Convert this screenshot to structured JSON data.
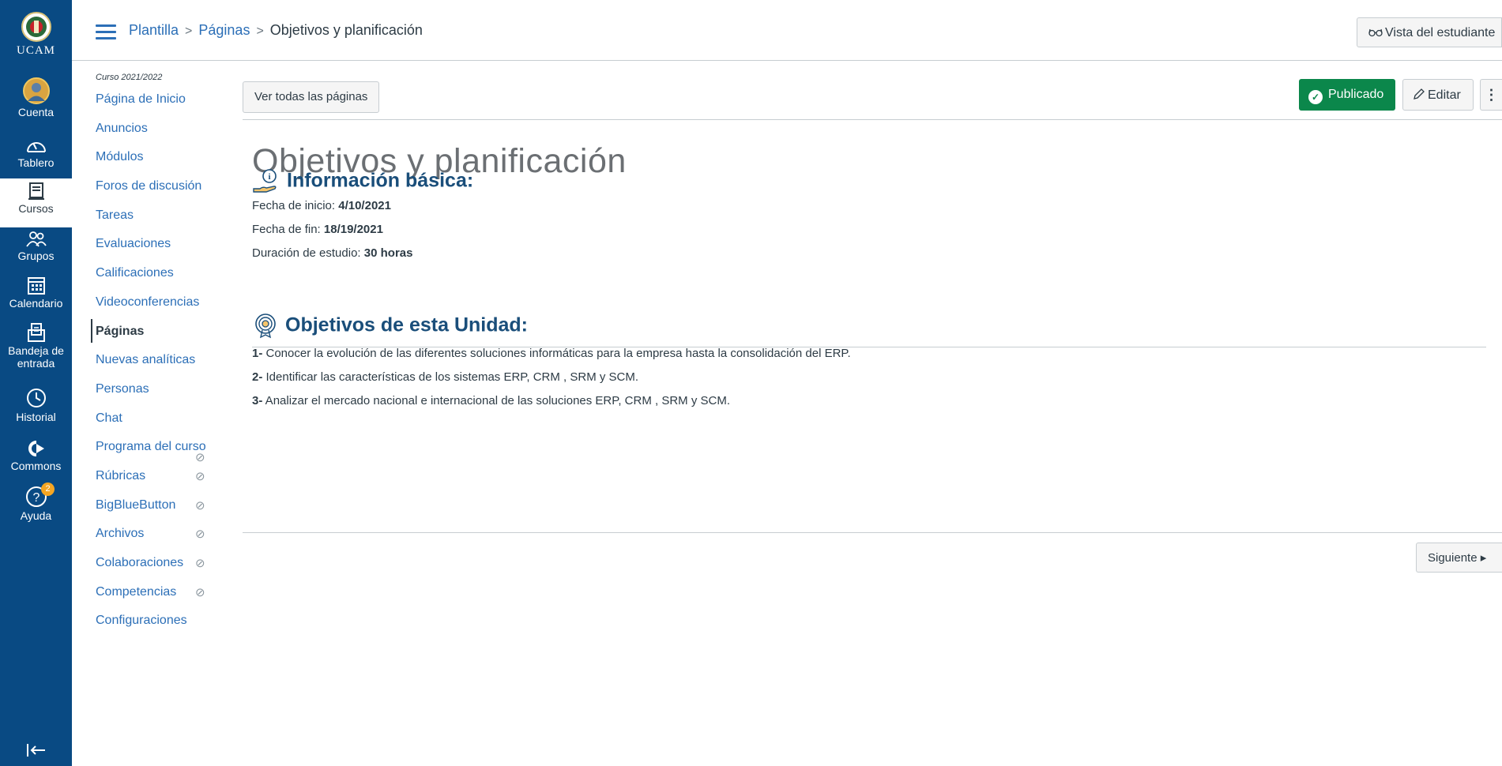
{
  "global_nav": {
    "logo_text": "UCAM",
    "items": [
      {
        "label": "Cuenta",
        "icon": "account-avatar"
      },
      {
        "label": "Tablero",
        "icon": "dashboard-icon"
      },
      {
        "label": "Cursos",
        "icon": "courses-icon"
      },
      {
        "label": "Grupos",
        "icon": "groups-icon"
      },
      {
        "label": "Calendario",
        "icon": "calendar-icon"
      },
      {
        "label_line1": "Bandeja de",
        "label_line2": "entrada",
        "icon": "inbox-icon"
      },
      {
        "label": "Historial",
        "icon": "history-icon"
      },
      {
        "label": "Commons",
        "icon": "commons-icon"
      },
      {
        "label": "Ayuda",
        "icon": "help-icon",
        "badge": "2"
      }
    ],
    "collapse_icon": "collapse-nav-icon"
  },
  "header": {
    "breadcrumb": [
      "Plantilla",
      "Páginas",
      "Objetivos y planificación"
    ],
    "student_view_label": "Vista del estudiante"
  },
  "course_nav": {
    "term": "Curso 2021/2022",
    "items": [
      {
        "label": "Página de Inicio"
      },
      {
        "label": "Anuncios"
      },
      {
        "label": "Módulos"
      },
      {
        "label": "Foros de discusión"
      },
      {
        "label": "Tareas"
      },
      {
        "label": "Evaluaciones"
      },
      {
        "label": "Calificaciones"
      },
      {
        "label": "Videoconferencias"
      },
      {
        "label": "Páginas",
        "active": true
      },
      {
        "label": "Nuevas analíticas"
      },
      {
        "label": "Personas"
      },
      {
        "label": "Chat"
      },
      {
        "label": "Programa del curso",
        "hidden": true
      },
      {
        "label": "Rúbricas",
        "hidden": true
      },
      {
        "label": "BigBlueButton",
        "hidden": true
      },
      {
        "label": "Archivos",
        "hidden": true
      },
      {
        "label": "Colaboraciones",
        "hidden": true
      },
      {
        "label": "Competencias",
        "hidden": true
      },
      {
        "label": "Configuraciones"
      }
    ]
  },
  "toolbar": {
    "view_all_label": "Ver todas las páginas",
    "published_label": "Publicado",
    "edit_label": "Editar",
    "more_label": "⋮"
  },
  "page": {
    "title": "Objetivos y planificación",
    "basic_info": {
      "heading": "Información básica:",
      "start_label": "Fecha de inicio: ",
      "start_value": "4/10/2021",
      "end_label": "Fecha de fin: ",
      "end_value": "18/19/2021",
      "duration_label": "Duración de estudio: ",
      "duration_value": "30 horas"
    },
    "objectives": {
      "heading": "Objetivos de esta Unidad:",
      "items": [
        {
          "num": "1-",
          "text": " Conocer la evolución de las diferentes soluciones informáticas para la empresa hasta la consolidación del ERP."
        },
        {
          "num": "2-",
          "text": " Identificar las características de los sistemas ERP, CRM , SRM y SCM."
        },
        {
          "num": "3-",
          "text": " Analizar el mercado nacional e internacional de las soluciones ERP, CRM , SRM y SCM."
        }
      ]
    },
    "next_label": "Siguiente ▸"
  },
  "colors": {
    "global_nav_bg": "#094a83",
    "link": "#2c6fb7",
    "published_green": "#0b874b",
    "heading_blue": "#1a4e7a"
  }
}
